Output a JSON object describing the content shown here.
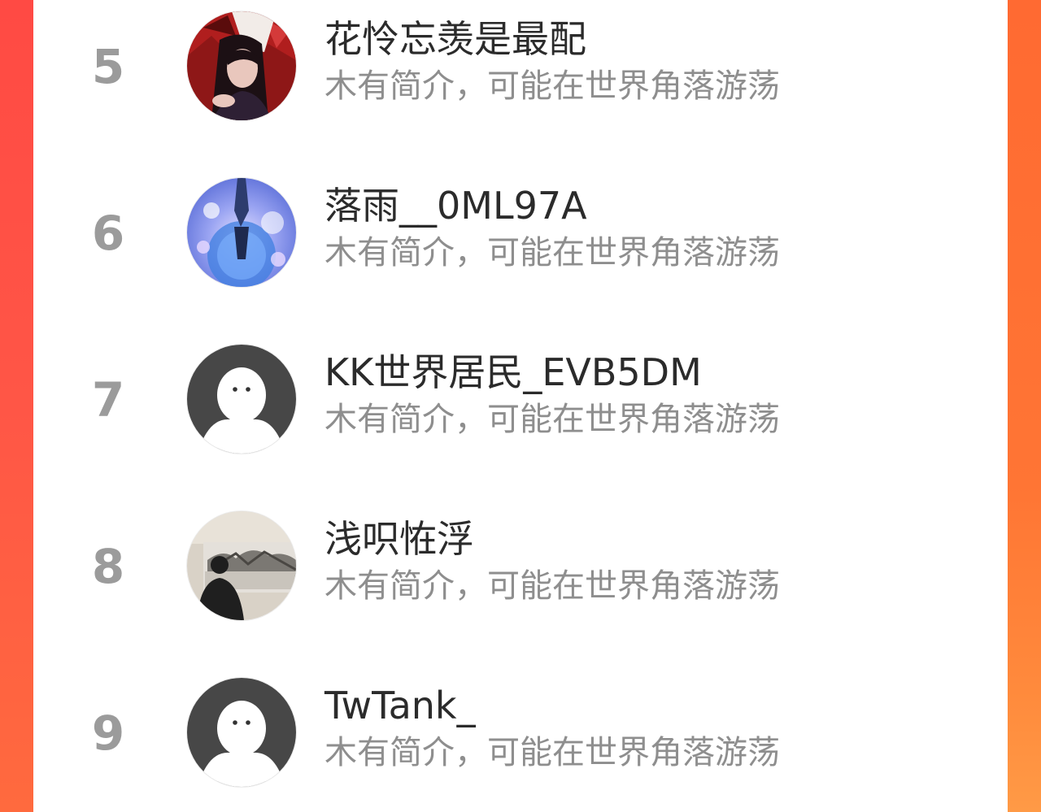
{
  "ranking": {
    "items": [
      {
        "rank": "5",
        "name": "花怜忘羡是最配",
        "bio": "木有简介，可能在世界角落游荡",
        "avatar": "anime-character-avatar"
      },
      {
        "rank": "6",
        "name": "落雨__0ML97A",
        "bio": "木有简介，可能在世界角落游荡",
        "avatar": "fantasy-illustration-avatar"
      },
      {
        "rank": "7",
        "name": "KK世界居民_EVB5DM",
        "bio": "木有简介，可能在世界角落游荡",
        "avatar": "default-user-avatar"
      },
      {
        "rank": "8",
        "name": "浅呮恠浮",
        "bio": "木有简介，可能在世界角落游荡",
        "avatar": "person-photo-avatar"
      },
      {
        "rank": "9",
        "name": "TwTank_",
        "bio": "木有简介，可能在世界角落游荡",
        "avatar": "default-user-avatar"
      }
    ]
  },
  "colors": {
    "background_accent": "#ff5a3d",
    "card": "#ffffff",
    "rank_text": "#9b9b9b",
    "name_text": "#2b2b2b",
    "bio_text": "#8e8e8e",
    "default_avatar_bg": "#474747"
  }
}
